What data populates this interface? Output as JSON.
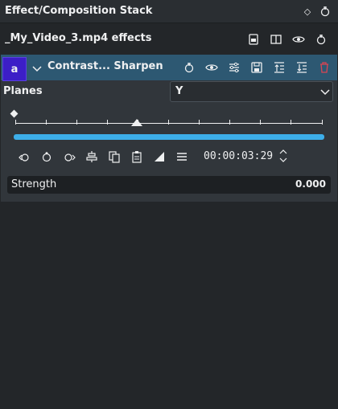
{
  "window": {
    "title": "Effect/Composition Stack",
    "title_buttons": [
      "float-icon",
      "close-icon"
    ]
  },
  "clip": {
    "name": "_My_Video_3.mp4 effects",
    "toolbar": [
      "save-stack-icon",
      "compare-icon",
      "eye-icon",
      "reset-icon"
    ]
  },
  "effect": {
    "badge": "a",
    "name": "Contrast... Sharpen",
    "header_buttons": [
      "reset-icon",
      "eye-icon",
      "settings-icon",
      "save-icon",
      "move-up-icon",
      "move-down-icon",
      "delete-icon"
    ],
    "planes": {
      "label": "Planes",
      "value": "Y"
    },
    "keyframe_buttons": [
      "previous-keyframe-icon",
      "add-keyframe-icon",
      "next-keyframe-icon",
      "align-icon",
      "copy-icon",
      "paste-icon",
      "interpolation-icon",
      "menu-icon"
    ],
    "timecode": "00:00:03:29",
    "params": [
      {
        "label": "Strength",
        "value": "0.000"
      }
    ]
  },
  "colors": {
    "accent": "#3daee9",
    "header": "#2d5872",
    "badge": "#3c1ec7",
    "delete": "#da4453"
  }
}
